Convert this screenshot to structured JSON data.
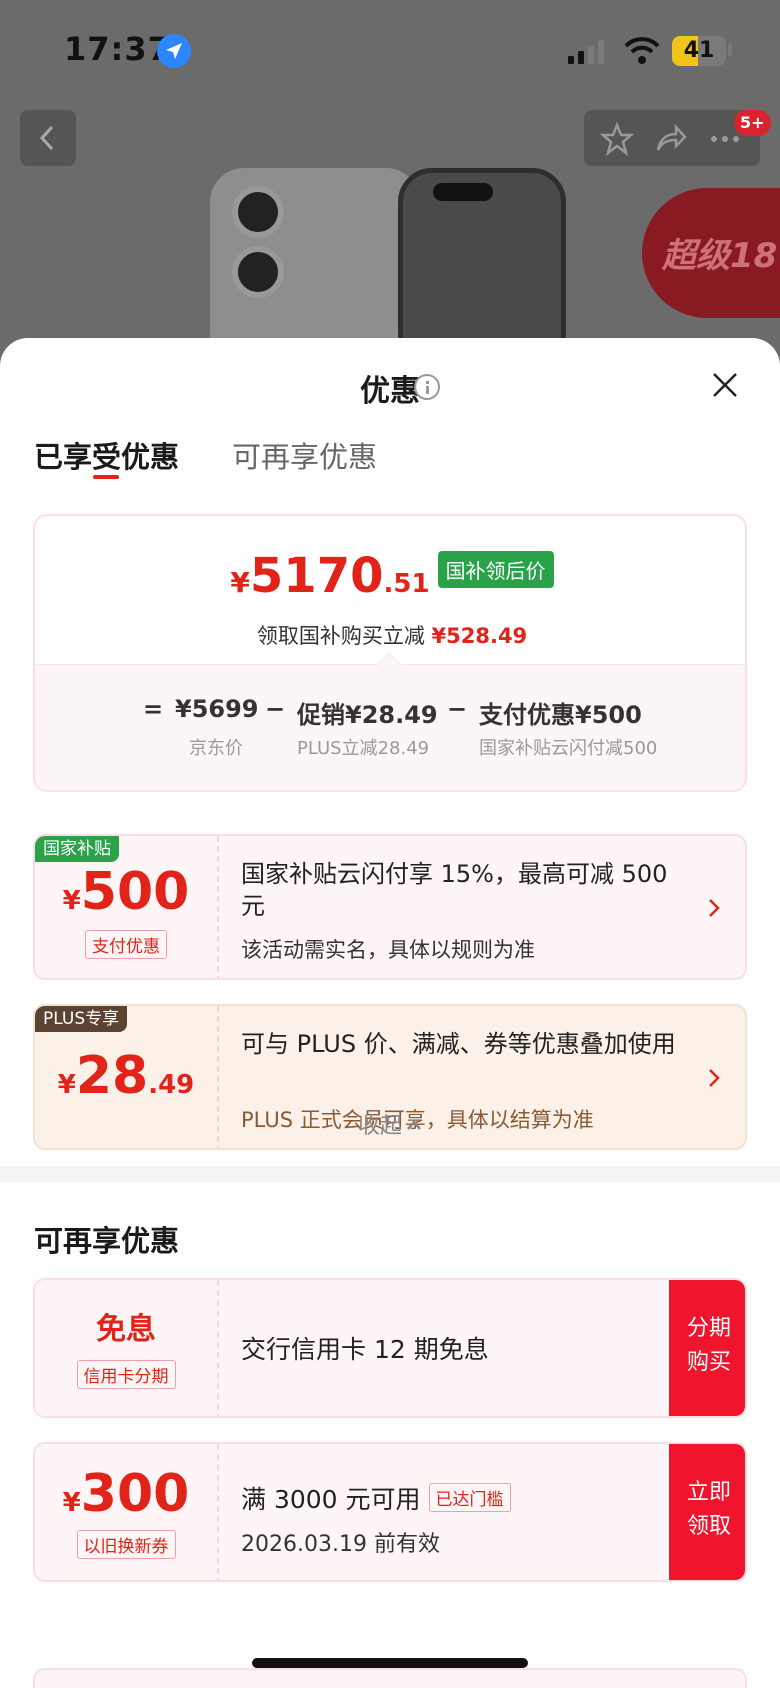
{
  "status_bar": {
    "time": "17:37",
    "battery": "41"
  },
  "product_bg": {
    "notification_badge": "5+",
    "promo_text": "超级18"
  },
  "sheet": {
    "title": "优惠",
    "tabs": [
      {
        "label": "已享受优惠"
      },
      {
        "label": "可再享优惠"
      }
    ],
    "summary": {
      "currency": "¥",
      "price_int": "5170",
      "price_dec": ".51",
      "price_tag": "国补领后价",
      "reduce_label": "领取国补购买立减",
      "reduce_amount": "¥528.49",
      "formula": {
        "eq": "=",
        "jd_price": "¥5699",
        "minus1": "−",
        "promo": "促销¥28.49",
        "minus2": "−",
        "pay": "支付优惠¥500"
      },
      "formula_labels": {
        "jd_price": "京东价",
        "promo": "PLUS立减28.49",
        "pay": "国家补贴云闪付减500"
      }
    },
    "coupons": [
      {
        "tag": "国家补贴",
        "currency": "¥",
        "amount_int": "500",
        "amount_dec": "",
        "sub": "支付优惠",
        "title": "国家补贴云闪付享 15%，最高可减 500 元",
        "desc": "该活动需实名，具体以规则为准"
      },
      {
        "tag": "PLUS专享",
        "currency": "¥",
        "amount_int": "28",
        "amount_dec": ".49",
        "title": "可与 PLUS 价、满减、券等优惠叠加使用",
        "desc": "PLUS 正式会员可享，具体以结算为准"
      }
    ],
    "collapse_label": "收起",
    "more_section": {
      "title": "可再享优惠",
      "items": [
        {
          "main": "免息",
          "sub": "信用卡分期",
          "title": "交行信用卡 12 期免息",
          "action": "分期购买"
        },
        {
          "currency": "¥",
          "amount_int": "300",
          "sub": "以旧换新券",
          "title": "满 3000 元可用",
          "badge": "已达门槛",
          "desc": "2026.03.19 前有效",
          "action": "立即领取"
        }
      ]
    }
  },
  "colors": {
    "accent_red": "#e2231a",
    "national_green": "#2aa24a",
    "plus_brown": "#5c4331"
  }
}
